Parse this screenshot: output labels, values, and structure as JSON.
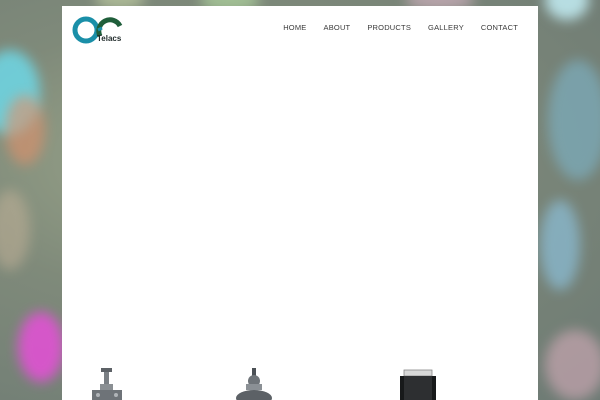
{
  "brand": {
    "name": "Telacs"
  },
  "nav": {
    "items": [
      {
        "label": "HOME"
      },
      {
        "label": "ABOUT"
      },
      {
        "label": "PRODUCTS"
      },
      {
        "label": "GALLERY"
      },
      {
        "label": "CONTACT"
      }
    ]
  },
  "colors": {
    "logo_teal": "#1a8fa8",
    "logo_green": "#1f5e3a",
    "panel": "#ffffff",
    "nav_text": "#3a3a3a"
  },
  "icons": [
    "logo-icon",
    "valve-product-icon",
    "actuator-product-icon",
    "cylinder-product-icon"
  ]
}
